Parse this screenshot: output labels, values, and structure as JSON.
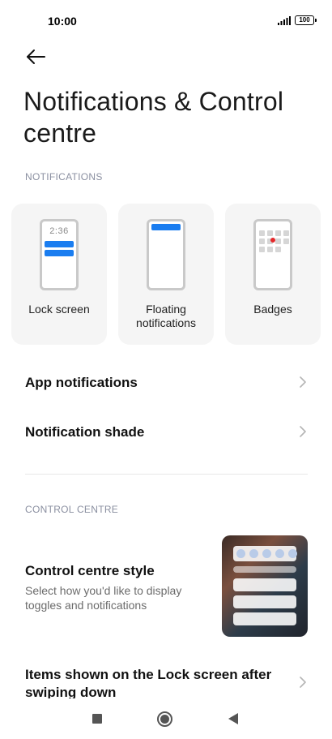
{
  "status_bar": {
    "time": "10:00",
    "signal_icon": "signal-bars-icon",
    "battery_level": "100"
  },
  "header": {
    "back_icon": "arrow-left-icon",
    "title": "Notifications & Control centre"
  },
  "notifications_section": {
    "header": "NOTIFICATIONS",
    "cards": [
      {
        "label": "Lock screen",
        "preview_time": "2:36",
        "icon": "lock-screen-phone-icon"
      },
      {
        "label": "Floating notifications",
        "icon": "floating-notification-phone-icon"
      },
      {
        "label": "Badges",
        "icon": "badges-phone-icon"
      }
    ]
  },
  "list_rows": [
    {
      "title": "App notifications",
      "icon": "chevron-right-icon"
    },
    {
      "title": "Notification shade",
      "icon": "chevron-right-icon"
    }
  ],
  "control_centre_section": {
    "header": "CONTROL CENTRE",
    "style_title": "Control centre style",
    "style_subtitle": "Select how you'd like to display toggles and notifications",
    "lock_items_title": "Items shown on the Lock screen after swiping down"
  },
  "nav_bar": {
    "recents_icon": "square-recents-icon",
    "home_icon": "circle-home-icon",
    "back_icon": "triangle-back-icon"
  },
  "colors": {
    "accent": "#1a7df0",
    "badge_red": "#e5282a",
    "section_header": "#8a8fa0",
    "card_bg": "#f5f5f5"
  }
}
